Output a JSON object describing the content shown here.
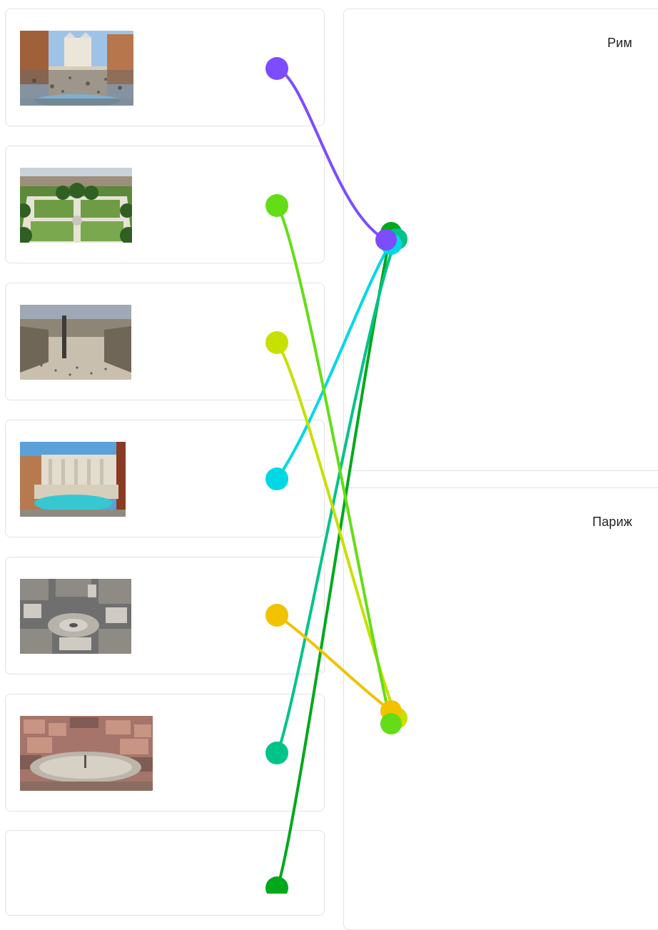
{
  "targets": [
    {
      "id": "rome",
      "label": "Рим"
    },
    {
      "id": "paris",
      "label": "Париж"
    }
  ],
  "items": [
    {
      "id": "spanish-steps",
      "image": "spanish-steps-photo",
      "color": "#7c4dff",
      "matched_to": "rome"
    },
    {
      "id": "place-des-vosges",
      "image": "place-des-vosges-photo",
      "color": "#64dd17",
      "matched_to": "paris"
    },
    {
      "id": "place-vendome",
      "image": "place-vendome-photo",
      "color": "#c6e000",
      "matched_to": "paris"
    },
    {
      "id": "trevi-fountain",
      "image": "trevi-fountain-photo",
      "color": "#00d8e6",
      "matched_to": "rome"
    },
    {
      "id": "place-des-victoires",
      "image": "place-des-victoires-photo",
      "color": "#f2c200",
      "matched_to": "paris"
    },
    {
      "id": "piazza-del-popolo",
      "image": "piazza-del-popolo-photo",
      "color": "#00c389",
      "matched_to": "rome"
    },
    {
      "id": "unseen-item",
      "image": null,
      "color": "#00a81c",
      "matched_to": "rome"
    }
  ]
}
